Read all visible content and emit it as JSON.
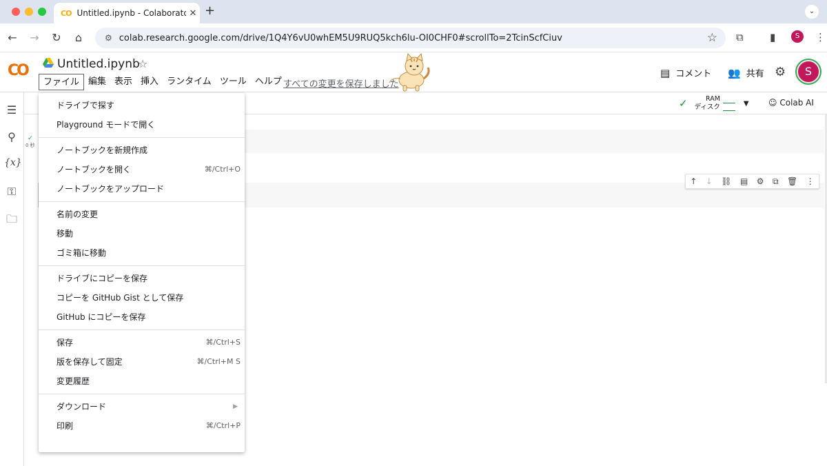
{
  "browser": {
    "tab_title": "Untitled.ipynb - Colaboratory",
    "tab_icon_text": "CO",
    "url": "colab.research.google.com/drive/1Q4Y6vU0whEM5U9RUQ5kch6lu-OI0CHF0#scrollTo=2TcinScfCiuv",
    "profile_initial": "S"
  },
  "colab": {
    "logo_text": "CO",
    "notebook_title": "Untitled.ipynb",
    "menus": [
      "ファイル",
      "編集",
      "表示",
      "挿入",
      "ランタイム",
      "ツール",
      "ヘルプ"
    ],
    "save_status": "すべての変更を保存しました",
    "comment_label": "コメント",
    "share_label": "共有",
    "avatar_initial": "S"
  },
  "runtime": {
    "ram_label": "RAM",
    "disk_label": "ディスク",
    "ai_label": "Colab AI"
  },
  "cell1": {
    "exec_time": "0 秒"
  },
  "file_menu": {
    "groups": [
      [
        {
          "label": "ドライブで探す",
          "shortcut": ""
        },
        {
          "label": "Playground モードで開く",
          "shortcut": ""
        }
      ],
      [
        {
          "label": "ノートブックを新規作成",
          "shortcut": ""
        },
        {
          "label": "ノートブックを開く",
          "shortcut": "⌘/Ctrl+O"
        },
        {
          "label": "ノートブックをアップロード",
          "shortcut": ""
        }
      ],
      [
        {
          "label": "名前の変更",
          "shortcut": ""
        },
        {
          "label": "移動",
          "shortcut": ""
        },
        {
          "label": "ゴミ箱に移動",
          "shortcut": ""
        }
      ],
      [
        {
          "label": "ドライブにコピーを保存",
          "shortcut": ""
        },
        {
          "label": "コピーを GitHub Gist として保存",
          "shortcut": ""
        },
        {
          "label": "GitHub にコピーを保存",
          "shortcut": ""
        }
      ],
      [
        {
          "label": "保存",
          "shortcut": "⌘/Ctrl+S"
        },
        {
          "label": "版を保存して固定",
          "shortcut": "⌘/Ctrl+M S"
        },
        {
          "label": "変更履歴",
          "shortcut": ""
        }
      ],
      [
        {
          "label": "ダウンロード",
          "shortcut": "",
          "submenu": true
        },
        {
          "label": "印刷",
          "shortcut": "⌘/Ctrl+P"
        }
      ]
    ]
  }
}
